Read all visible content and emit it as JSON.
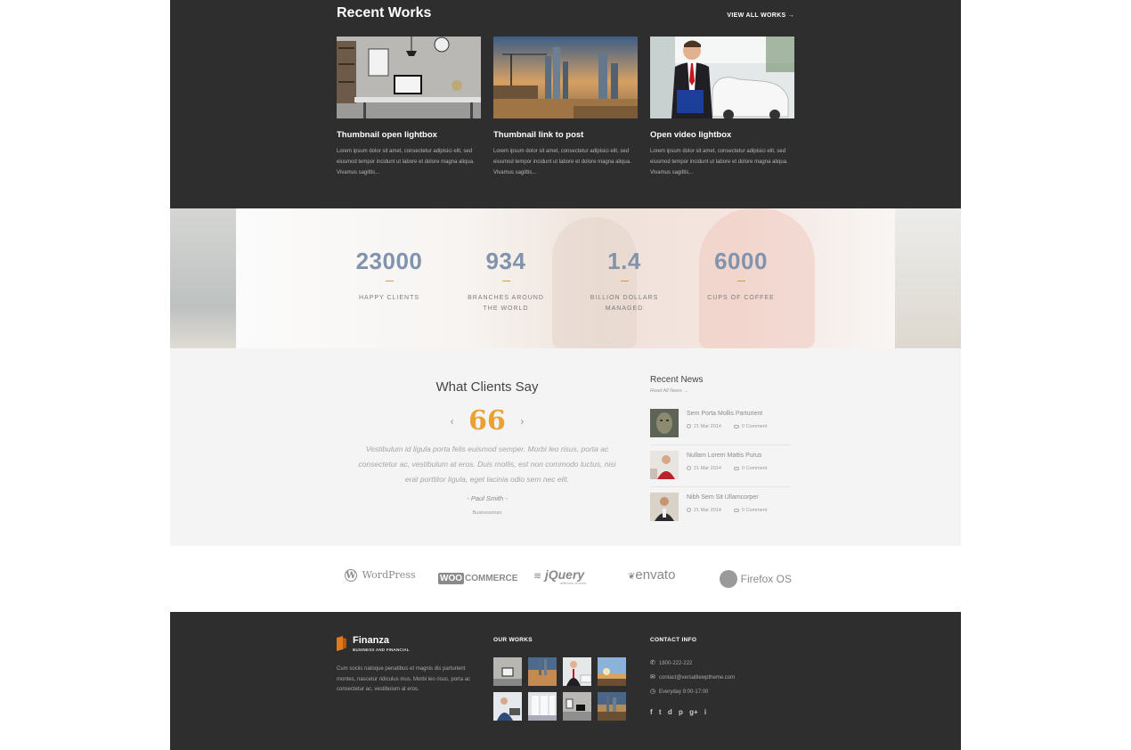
{
  "recent_works": {
    "title": "Recent Works",
    "view_all": "VIEW ALL WORKS →",
    "items": [
      {
        "title": "Thumbnail open lightbox",
        "desc": "Lorem ipsum dolor sit amet, consectetur adipisici elit, sed eiusmod tempor incidunt ut labore et dolore magna aliqua. Vivamus sagittis..."
      },
      {
        "title": "Thumbnail link to post",
        "desc": "Lorem ipsum dolor sit amet, consectetur adipisici elit, sed eiusmod tempor incidunt ut labore et dolore magna aliqua. Vivamus sagittis..."
      },
      {
        "title": "Open video lightbox",
        "desc": "Lorem ipsum dolor sit amet, consectetur adipisici elit, sed eiusmod tempor incidunt ut labore et dolore magna aliqua. Vivamus sagittis..."
      }
    ]
  },
  "counters": [
    {
      "number": "23000",
      "label": "HAPPY CLIENTS"
    },
    {
      "number": "934",
      "label": "BRANCHES AROUND THE WORLD"
    },
    {
      "number": "1.4",
      "label": "BILLION DOLLARS MANAGED"
    },
    {
      "number": "6000",
      "label": "CUPS OF COFFEE"
    }
  ],
  "testimonials": {
    "title": "What Clients Say",
    "prev": "‹",
    "next": "›",
    "quote_mark": "66",
    "text": "Vestibulum id ligula porta felis euismod semper. Morbi leo risus, porta ac consectetur ac, vestibulum at eros. Duis mollis, est non commodo luctus, nisi erat porttitor ligula, eget lacinia odio sem nec elit.",
    "author": "- Paul Smith -",
    "role": "Businessman"
  },
  "news": {
    "title": "Recent News",
    "read_all": "Read All News →",
    "items": [
      {
        "title": "Sem Porta Mollis Parturient",
        "date": "21 Mar 2014",
        "comments": "0 Comment"
      },
      {
        "title": "Nullam Lorem Mattis Purus",
        "date": "21 Mar 2014",
        "comments": "0 Comment"
      },
      {
        "title": "Nibh Sem Sit Ullamcorper",
        "date": "21 Mar 2014",
        "comments": "0 Comment"
      }
    ]
  },
  "partners": {
    "wordpress": "WordPress",
    "woo_a": "WOO",
    "woo_b": "COMMERCE",
    "jquery": "jQuery",
    "jquery_tag": "write less, do more.",
    "envato": "envato",
    "firefox": "Firefox OS"
  },
  "footer": {
    "brand_name": "Finanza",
    "brand_tagline": "BUSINESS AND FINANCIAL",
    "about": "Cum sociis natoque penatibus et magnis dis parturient montes, nascetur ridiculus mus. Morbi leo risus, porta ac consectetur ac, vestibulum at eros.",
    "works_title": "OUR WORKS",
    "contact_title": "CONTACT INFO",
    "phone": "1800-222-222",
    "email": "contact@versatilewptheme.com",
    "hours": "Everyday 9:00-17:00",
    "social": [
      "f",
      "t",
      "d",
      "p",
      "g+",
      "i"
    ]
  },
  "colors": {
    "dark_bg": "#2e2e2e",
    "counter_number": "#8193ad",
    "accent_orange": "#e8a132",
    "light_bg": "#f4f4f4"
  }
}
